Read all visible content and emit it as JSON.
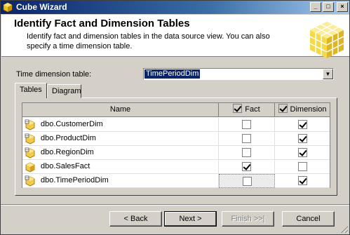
{
  "window": {
    "title": "Cube Wizard"
  },
  "header": {
    "title": "Identify Fact and Dimension Tables",
    "description": "Identify fact and dimension tables in the data source view. You can also specify a time dimension table."
  },
  "time_dimension": {
    "label": "Time dimension table:",
    "value": "TimePeriodDim"
  },
  "tabs": [
    {
      "label": "Tables",
      "active": true
    },
    {
      "label": "Diagram",
      "active": false
    }
  ],
  "grid": {
    "columns": {
      "name": "Name",
      "fact": "Fact",
      "dimension": "Dimension"
    },
    "rows": [
      {
        "name": "dbo.CustomerDim",
        "fact": false,
        "dimension": true,
        "icon": "dimension-table-icon"
      },
      {
        "name": "dbo.ProductDim",
        "fact": false,
        "dimension": true,
        "icon": "dimension-table-icon"
      },
      {
        "name": "dbo.RegionDim",
        "fact": false,
        "dimension": true,
        "icon": "dimension-table-icon"
      },
      {
        "name": "dbo.SalesFact",
        "fact": true,
        "dimension": false,
        "icon": "fact-table-icon"
      },
      {
        "name": "dbo.TimePeriodDim",
        "fact": false,
        "dimension": true,
        "icon": "time-dimension-table-icon"
      }
    ]
  },
  "buttons": {
    "back": "< Back",
    "next": "Next >",
    "finish": "Finish >>|",
    "cancel": "Cancel"
  }
}
